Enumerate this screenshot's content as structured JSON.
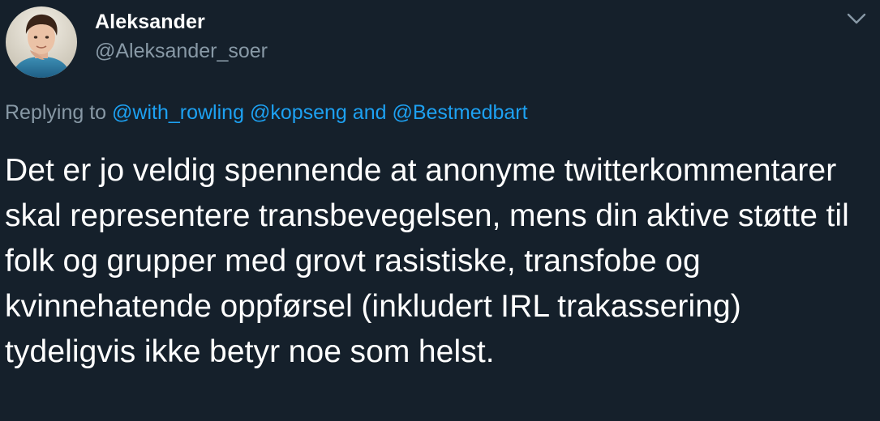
{
  "tweet": {
    "display_name": "Aleksander",
    "handle": "@Aleksander_soer",
    "reply_prefix": "Replying to",
    "mentions": [
      "@with_rowling",
      "@kopseng",
      "@Bestmedbart"
    ],
    "mention_separator": "and",
    "body": "Det er jo veldig spennende at anonyme twitterkommentarer skal representere transbevegelsen, mens din aktive støtte til folk og grupper med grovt rasistiske, transfobe og kvinnehatende oppførsel (inkludert IRL trakassering) tydeligvis ikke betyr noe som helst."
  },
  "icons": {
    "more": "chevron-down-icon",
    "avatar": "avatar"
  },
  "colors": {
    "background": "#15202b",
    "text_primary": "#ffffff",
    "text_secondary": "#8899a6",
    "accent": "#1da1f2"
  }
}
